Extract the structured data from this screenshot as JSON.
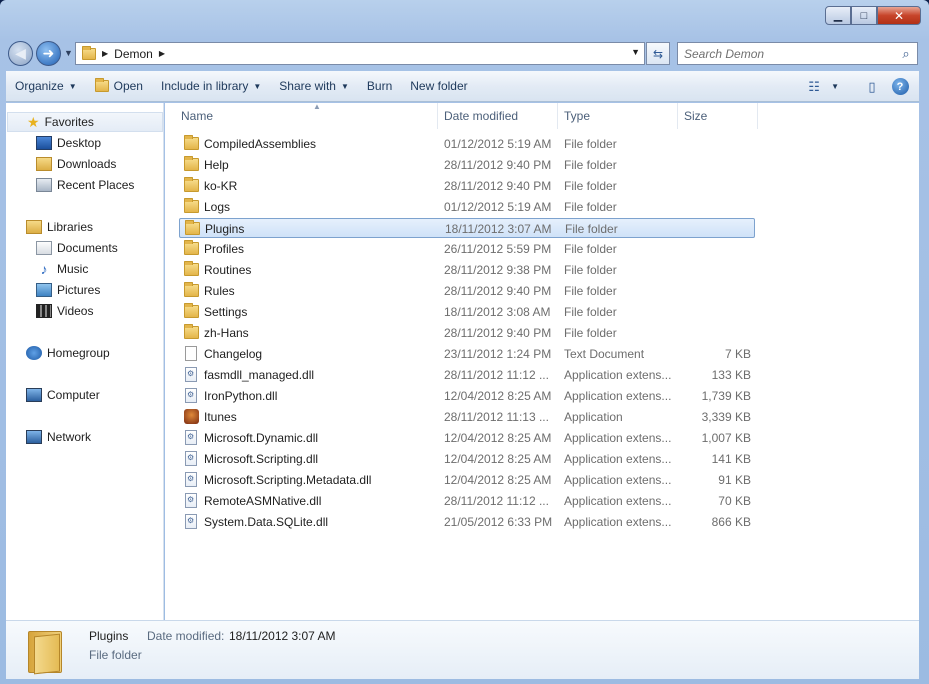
{
  "window": {
    "caption": {
      "minimize": "▁",
      "maximize": "□",
      "close": "✕"
    }
  },
  "address_bar": {
    "breadcrumb": [
      "Demon"
    ],
    "search_placeholder": "Search Demon"
  },
  "toolbar": {
    "organize": "Organize",
    "open": "Open",
    "include_in_library": "Include in library",
    "share_with": "Share with",
    "burn": "Burn",
    "new_folder": "New folder",
    "help": "?"
  },
  "nav_pane": {
    "favorites": {
      "label": "Favorites",
      "items": [
        "Desktop",
        "Downloads",
        "Recent Places"
      ]
    },
    "libraries": {
      "label": "Libraries",
      "items": [
        "Documents",
        "Music",
        "Pictures",
        "Videos"
      ]
    },
    "homegroup": "Homegroup",
    "computer": "Computer",
    "network": "Network"
  },
  "columns": {
    "name": "Name",
    "date": "Date modified",
    "type": "Type",
    "size": "Size"
  },
  "files": [
    {
      "name": "CompiledAssemblies",
      "date": "01/12/2012 5:19 AM",
      "type": "File folder",
      "size": "",
      "kind": "folder"
    },
    {
      "name": "Help",
      "date": "28/11/2012 9:40 PM",
      "type": "File folder",
      "size": "",
      "kind": "folder"
    },
    {
      "name": "ko-KR",
      "date": "28/11/2012 9:40 PM",
      "type": "File folder",
      "size": "",
      "kind": "folder"
    },
    {
      "name": "Logs",
      "date": "01/12/2012 5:19 AM",
      "type": "File folder",
      "size": "",
      "kind": "folder"
    },
    {
      "name": "Plugins",
      "date": "18/11/2012 3:07 AM",
      "type": "File folder",
      "size": "",
      "kind": "folder",
      "selected": true
    },
    {
      "name": "Profiles",
      "date": "26/11/2012 5:59 PM",
      "type": "File folder",
      "size": "",
      "kind": "folder"
    },
    {
      "name": "Routines",
      "date": "28/11/2012 9:38 PM",
      "type": "File folder",
      "size": "",
      "kind": "folder"
    },
    {
      "name": "Rules",
      "date": "28/11/2012 9:40 PM",
      "type": "File folder",
      "size": "",
      "kind": "folder"
    },
    {
      "name": "Settings",
      "date": "18/11/2012 3:08 AM",
      "type": "File folder",
      "size": "",
      "kind": "folder"
    },
    {
      "name": "zh-Hans",
      "date": "28/11/2012 9:40 PM",
      "type": "File folder",
      "size": "",
      "kind": "folder"
    },
    {
      "name": "Changelog",
      "date": "23/11/2012 1:24 PM",
      "type": "Text Document",
      "size": "7 KB",
      "kind": "doc"
    },
    {
      "name": "fasmdll_managed.dll",
      "date": "28/11/2012 11:12 ...",
      "type": "Application extens...",
      "size": "133 KB",
      "kind": "dll"
    },
    {
      "name": "IronPython.dll",
      "date": "12/04/2012 8:25 AM",
      "type": "Application extens...",
      "size": "1,739 KB",
      "kind": "dll"
    },
    {
      "name": "Itunes",
      "date": "28/11/2012 11:13 ...",
      "type": "Application",
      "size": "3,339 KB",
      "kind": "app"
    },
    {
      "name": "Microsoft.Dynamic.dll",
      "date": "12/04/2012 8:25 AM",
      "type": "Application extens...",
      "size": "1,007 KB",
      "kind": "dll"
    },
    {
      "name": "Microsoft.Scripting.dll",
      "date": "12/04/2012 8:25 AM",
      "type": "Application extens...",
      "size": "141 KB",
      "kind": "dll"
    },
    {
      "name": "Microsoft.Scripting.Metadata.dll",
      "date": "12/04/2012 8:25 AM",
      "type": "Application extens...",
      "size": "91 KB",
      "kind": "dll"
    },
    {
      "name": "RemoteASMNative.dll",
      "date": "28/11/2012 11:12 ...",
      "type": "Application extens...",
      "size": "70 KB",
      "kind": "dll"
    },
    {
      "name": "System.Data.SQLite.dll",
      "date": "21/05/2012 6:33 PM",
      "type": "Application extens...",
      "size": "866 KB",
      "kind": "dll"
    }
  ],
  "details_pane": {
    "name": "Plugins",
    "modified_label": "Date modified:",
    "modified_value": "18/11/2012 3:07 AM",
    "type": "File folder"
  }
}
